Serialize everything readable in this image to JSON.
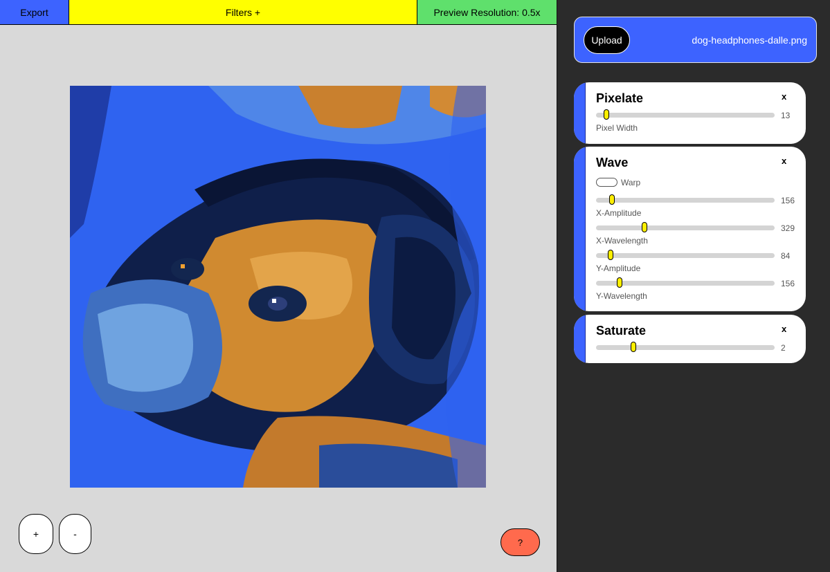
{
  "toolbar": {
    "export_label": "Export",
    "filters_label": "Filters +",
    "resolution_label": "Preview Resolution: 0.5x",
    "colors": {
      "export": "#3d63ff",
      "filters": "#ffff00",
      "resolution": "#5fe06c"
    }
  },
  "canvas": {
    "image_alt_icon": "dog-headphones-image"
  },
  "zoom": {
    "in_label": "+",
    "out_label": "-"
  },
  "help": {
    "label": "?",
    "color": "#ff6a4d"
  },
  "upload": {
    "button_label": "Upload",
    "filename": "dog-headphones-dalle.png",
    "color": "#3d63ff"
  },
  "filters": [
    {
      "title": "Pixelate",
      "close": "x",
      "sliders": [
        {
          "label": "Pixel Width",
          "value": "13",
          "fraction": 0.06
        }
      ]
    },
    {
      "title": "Wave",
      "close": "x",
      "toggle": {
        "label": "Warp",
        "on": false
      },
      "sliders": [
        {
          "label": "X-Amplitude",
          "value": "156",
          "fraction": 0.09
        },
        {
          "label": "X-Wavelength",
          "value": "329",
          "fraction": 0.27
        },
        {
          "label": "Y-Amplitude",
          "value": "84",
          "fraction": 0.08
        },
        {
          "label": "Y-Wavelength",
          "value": "156",
          "fraction": 0.13
        }
      ]
    },
    {
      "title": "Saturate",
      "close": "x",
      "sliders": [
        {
          "label": "",
          "value": "2",
          "fraction": 0.21
        }
      ]
    }
  ]
}
